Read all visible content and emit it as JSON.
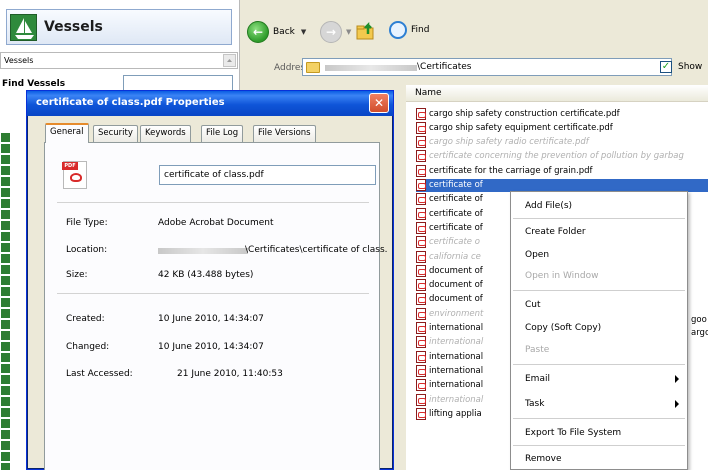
{
  "left_pane": {
    "header_title": "Vessels",
    "dropdown_label": "Vessels",
    "find_label": "Find Vessels"
  },
  "toolbar": {
    "back_label": "Back",
    "find_label": "Find",
    "address_label": "Address",
    "address_path": "\\Certificates",
    "show_label": "Show",
    "show_checked": true
  },
  "file_list": {
    "header": "Name",
    "files": [
      {
        "name": "cargo ship safety construction certificate.pdf",
        "italic": false,
        "selected": false
      },
      {
        "name": "cargo ship safety equipment certificate.pdf",
        "italic": false,
        "selected": false
      },
      {
        "name": "cargo ship safety radio certificate.pdf",
        "italic": true,
        "selected": false
      },
      {
        "name": "certificate concerning the prevention of pollution by garbag",
        "italic": true,
        "selected": false
      },
      {
        "name": "certificate for the carriage of grain.pdf",
        "italic": false,
        "selected": false
      },
      {
        "name": "certificate of",
        "italic": false,
        "selected": true
      },
      {
        "name": "certificate of",
        "italic": false,
        "selected": false
      },
      {
        "name": "certificate of",
        "italic": false,
        "selected": false
      },
      {
        "name": "certificate of",
        "italic": false,
        "selected": false
      },
      {
        "name": "certificate o",
        "italic": true,
        "selected": false
      },
      {
        "name": "california ce",
        "italic": true,
        "selected": false
      },
      {
        "name": "document of",
        "italic": false,
        "selected": false
      },
      {
        "name": "document of",
        "italic": false,
        "selected": false
      },
      {
        "name": "document of",
        "italic": false,
        "selected": false
      },
      {
        "name": "environment",
        "italic": true,
        "selected": false
      },
      {
        "name": "international",
        "italic": false,
        "selected": false
      },
      {
        "name": "international",
        "italic": true,
        "selected": false
      },
      {
        "name": "international",
        "italic": false,
        "selected": false
      },
      {
        "name": "international",
        "italic": false,
        "selected": false
      },
      {
        "name": "international",
        "italic": false,
        "selected": false
      },
      {
        "name": "international",
        "italic": true,
        "selected": false
      },
      {
        "name": "lifting applia",
        "italic": false,
        "selected": false
      }
    ],
    "trailing_fragments": [
      "goo",
      "argc"
    ]
  },
  "context_menu": {
    "items": [
      {
        "label": "Add File(s)",
        "disabled": false,
        "submenu": false
      },
      {
        "label": "Create Folder",
        "disabled": false,
        "submenu": false
      },
      {
        "label": "Open",
        "disabled": false,
        "submenu": false
      },
      {
        "label": "Open in Window",
        "disabled": true,
        "submenu": false
      },
      {
        "label": "Cut",
        "disabled": false,
        "submenu": false
      },
      {
        "label": "Copy (Soft Copy)",
        "disabled": false,
        "submenu": false
      },
      {
        "label": "Paste",
        "disabled": true,
        "submenu": false
      },
      {
        "label": "Email",
        "disabled": false,
        "submenu": true
      },
      {
        "label": "Task",
        "disabled": false,
        "submenu": true
      },
      {
        "label": "Export To File System",
        "disabled": false,
        "submenu": false
      },
      {
        "label": "Remove",
        "disabled": false,
        "submenu": false
      }
    ]
  },
  "dialog": {
    "title": "certificate of class.pdf Properties",
    "close_glyph": "✕",
    "tabs": [
      "General",
      "Security",
      "Keywords",
      "File Log",
      "File Versions"
    ],
    "active_tab": "General",
    "pdf_badge": "PDF",
    "filename": "certificate of class.pdf",
    "properties": {
      "file_type_label": "File Type:",
      "file_type_value": "Adobe Acrobat Document",
      "location_label": "Location:",
      "location_value": "\\Certificates\\certificate of class.",
      "size_label": "Size:",
      "size_value": "42 KB (43.488 bytes)",
      "created_label": "Created:",
      "created_value": "10 June 2010, 14:34:07",
      "changed_label": "Changed:",
      "changed_value": "10 June 2010, 14:34:07",
      "accessed_label": "Last Accessed:",
      "accessed_value": "21 June 2010, 11:40:53"
    }
  },
  "colors": {
    "titlebar": "#0a5ce3",
    "selection": "#3169c6",
    "vessel_green": "#2e7d32",
    "tab_accent": "#e68b2c"
  }
}
